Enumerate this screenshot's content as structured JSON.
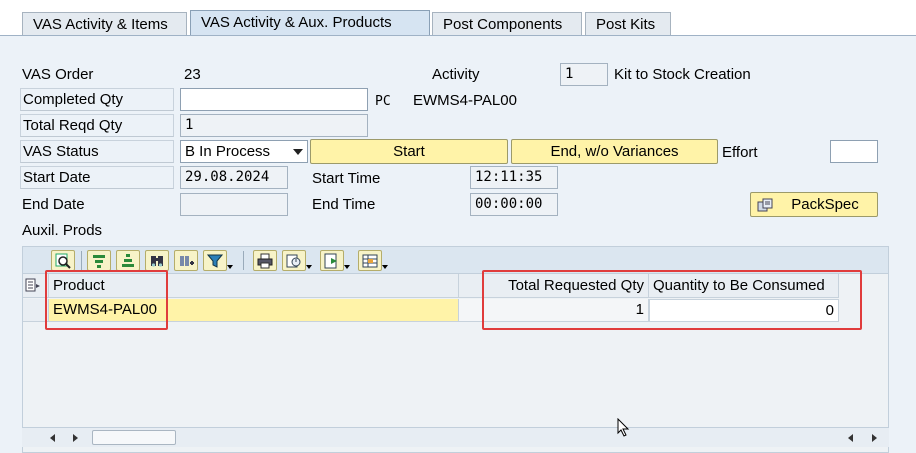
{
  "tabs": [
    {
      "label": "VAS Activity & Items"
    },
    {
      "label": "VAS Activity & Aux. Products"
    },
    {
      "label": "Post Components"
    },
    {
      "label": "Post Kits"
    }
  ],
  "form": {
    "vas_order_label": "VAS Order",
    "vas_order_value": "23",
    "activity_label": "Activity",
    "activity_value": "1",
    "activity_desc": "Kit to Stock Creation",
    "completed_qty_label": "Completed Qty",
    "completed_qty_value": "",
    "completed_qty_unit": "PC",
    "product_code": "EWMS4-PAL00",
    "total_reqd_qty_label": "Total Reqd Qty",
    "total_reqd_qty_value": "1",
    "vas_status_label": "VAS Status",
    "vas_status_value": "B In Process",
    "start_button": "Start",
    "end_wo_var_button": "End, w/o Variances",
    "effort_label": "Effort",
    "effort_value": "",
    "start_date_label": "Start Date",
    "start_date_value": "29.08.2024",
    "start_time_label": "Start Time",
    "start_time_value": "12:11:35",
    "end_date_label": "End Date",
    "end_date_value": "",
    "end_time_label": "End Time",
    "end_time_value": "00:00:00",
    "packspec_button": "PackSpec",
    "auxil_prods_label": "Auxil. Prods"
  },
  "table": {
    "columns": [
      "Product",
      "Total Requested Qty",
      "Quantity to Be Consumed"
    ],
    "rows": [
      {
        "product": "EWMS4-PAL00",
        "total_requested_qty": "1",
        "qty_to_be_consumed": "0"
      }
    ]
  },
  "colors": {
    "highlight_box": "#e03c3c",
    "button_yellow": "#fff3a8",
    "panel_bg": "#ecf2f8"
  }
}
